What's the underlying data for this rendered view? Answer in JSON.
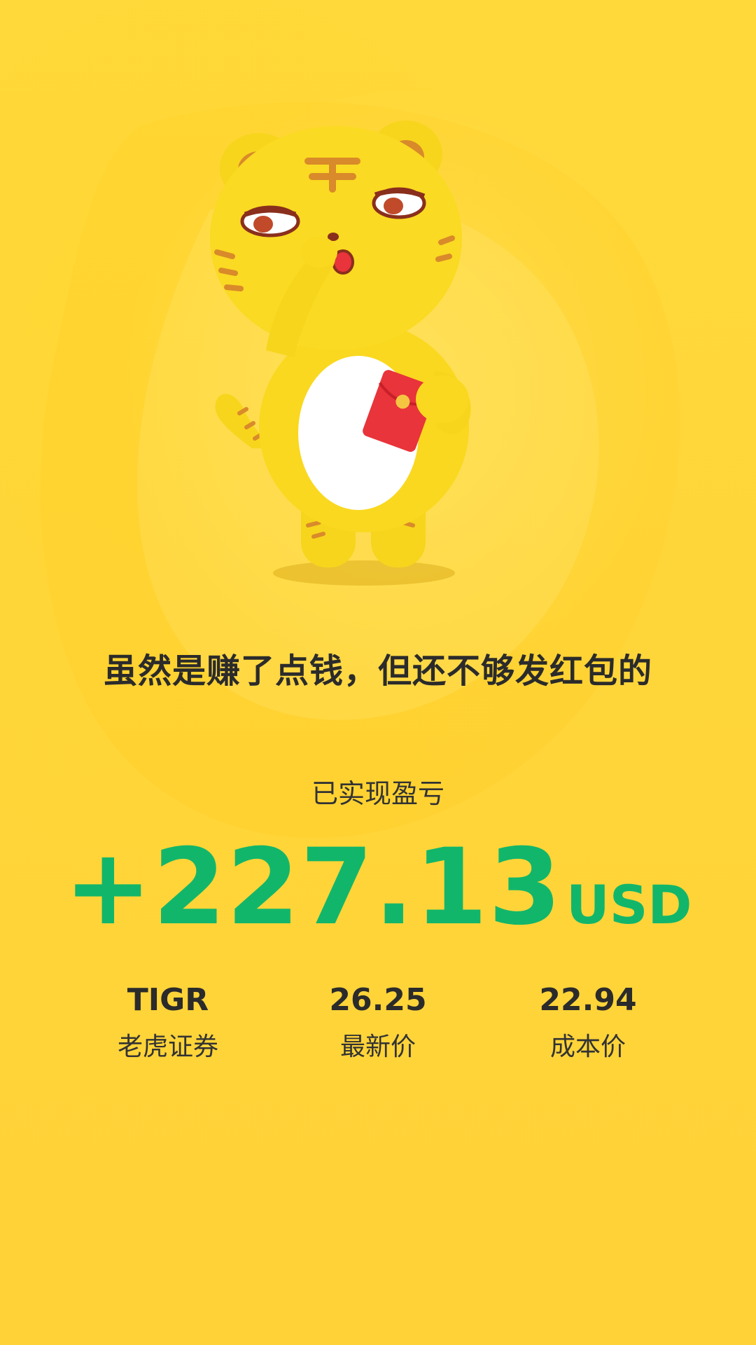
{
  "headline": "虽然是赚了点钱，但还不够发红包的",
  "pnl": {
    "label": "已实现盈亏",
    "value": "+227.13",
    "currency": "USD"
  },
  "stats": [
    {
      "value": "TIGR",
      "label": "老虎证券"
    },
    {
      "value": "26.25",
      "label": "最新价"
    },
    {
      "value": "22.94",
      "label": "成本价"
    }
  ],
  "colors": {
    "background": "#ffd63a",
    "profit_green": "#12b66a",
    "text_dark": "#2b2b2b",
    "red_envelope": "#e8343a"
  },
  "icons": {
    "mascot": "tiger-mascot-holding-red-envelope"
  }
}
